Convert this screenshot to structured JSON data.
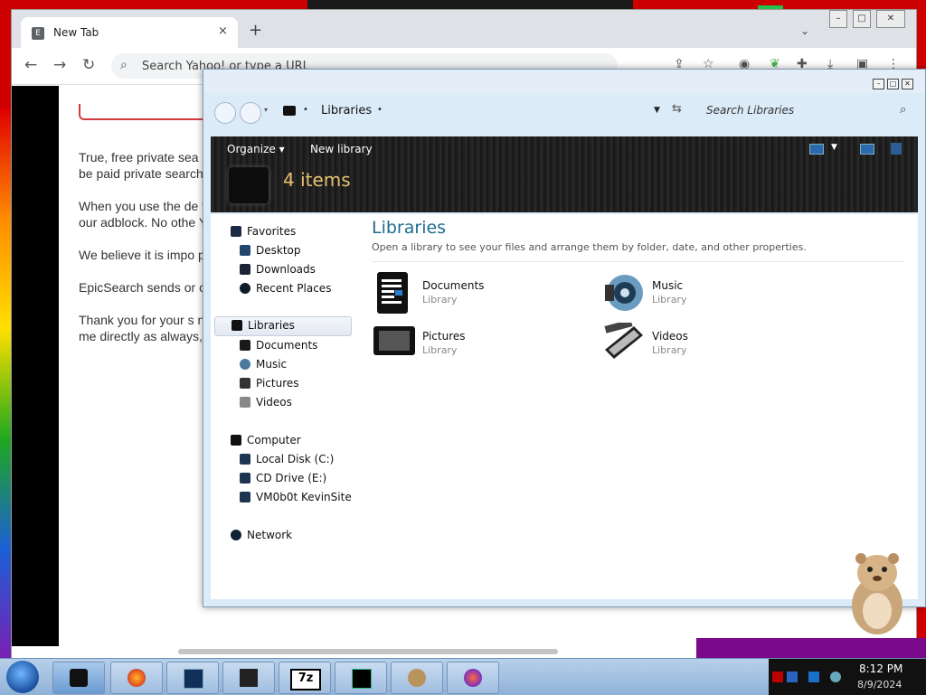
{
  "browser": {
    "tab_title": "New Tab",
    "tab_close": "×",
    "new_tab": "+",
    "tab_favicon_letter": "E",
    "omnibox_placeholder": "Search Yahoo! or type a URL",
    "back": "←",
    "forward": "→",
    "reload": "↻"
  },
  "article": {
    "paragraphs": [
      "True, free private sea search partnership si thousands of you) ov everyday. Our encryp project, we had to be paid private search v",
      "When you use the de frequent releases an privacy and security. Yahoo search, the pr marketplace. Due to our adblock. No othe Yahoo sites.",
      "We believe it is impo private search engine mandates to share a claim to be private if to us how they work.",
      "EpicSearch sends or continues to be the o a nominal $2.50 a m",
      "Thank you for your s now be on a sustaina know (even moreso v share your thoughts and questions with me directly as always, alok at hiddenreflex dot com."
    ]
  },
  "explorer": {
    "breadcrumb": "Libraries",
    "crumb_arrow": "•",
    "search_placeholder": "Search Libraries",
    "cmd_organize": "Organize ▾",
    "cmd_new_library": "New library",
    "items_count": "4 items",
    "heading": "Libraries",
    "description": "Open a library to see your files and arrange them by folder, date, and other properties.",
    "nav": {
      "favorites": "Favorites",
      "desktop": "Desktop",
      "downloads": "Downloads",
      "recent_places": "Recent Places",
      "libraries": "Libraries",
      "documents": "Documents",
      "music": "Music",
      "pictures": "Pictures",
      "videos": "Videos",
      "computer": "Computer",
      "local_disk": "Local Disk (C:)",
      "cd_drive": "CD Drive (E:)",
      "vm_share": "VM0b0t KevinSite",
      "network": "Network"
    },
    "libraries": [
      {
        "name": "Documents",
        "type": "Library"
      },
      {
        "name": "Music",
        "type": "Library"
      },
      {
        "name": "Pictures",
        "type": "Library"
      },
      {
        "name": "Videos",
        "type": "Library"
      }
    ]
  },
  "taskbar": {
    "time": "8:12 PM",
    "date": "8/9/2024",
    "sevenzip_label": "7z"
  },
  "colors": {
    "accent_heading": "#1e6b8f",
    "items_count": "#e8c070"
  }
}
